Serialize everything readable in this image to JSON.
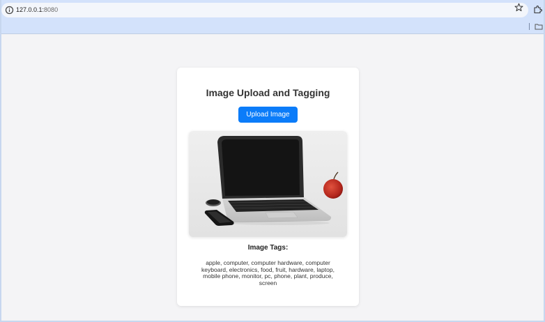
{
  "browser": {
    "url_host": "127.0.0.1:",
    "url_port": "8080"
  },
  "page": {
    "title": "Image Upload and Tagging",
    "upload_button_label": "Upload Image",
    "tags_heading": "Image Tags:",
    "tags": "apple, computer, computer hardware, computer keyboard, electronics, food, fruit, hardware, laptop, mobile phone, monitor, pc, phone, plant, produce, screen"
  },
  "colors": {
    "accent": "#0b7cf9",
    "browser_chrome": "#d3e2fb",
    "page_background": "#f4f4f6"
  },
  "icons": [
    "site-info-icon",
    "bookmark-star-icon",
    "extensions-icon",
    "bookmarks-folder-icon"
  ]
}
